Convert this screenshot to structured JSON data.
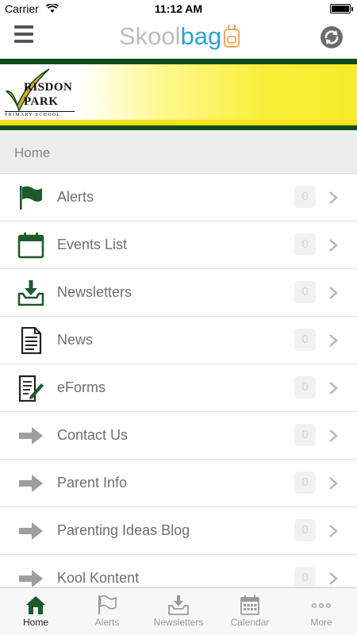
{
  "status_bar": {
    "carrier": "Carrier",
    "time": "11:12 AM"
  },
  "navbar": {
    "brand_part1": "Skool",
    "brand_part2": "bag"
  },
  "banner": {
    "school_line1": "RISDON",
    "school_line2": "PARK",
    "school_line3": "PRIMARY SCHOOL"
  },
  "section": {
    "title": "Home"
  },
  "menu_items": [
    {
      "label": "Alerts",
      "count": "0",
      "icon": "flag-icon"
    },
    {
      "label": "Events List",
      "count": "0",
      "icon": "calendar-icon"
    },
    {
      "label": "Newsletters",
      "count": "0",
      "icon": "inbox-download-icon"
    },
    {
      "label": "News",
      "count": "0",
      "icon": "document-icon"
    },
    {
      "label": "eForms",
      "count": "0",
      "icon": "form-edit-icon"
    },
    {
      "label": "Contact Us",
      "count": "0",
      "icon": "arrow-right-icon"
    },
    {
      "label": "Parent Info",
      "count": "0",
      "icon": "arrow-right-icon"
    },
    {
      "label": "Parenting Ideas Blog",
      "count": "0",
      "icon": "arrow-right-icon"
    },
    {
      "label": "Kool Kontent",
      "count": "0",
      "icon": "arrow-right-icon"
    }
  ],
  "tabs": [
    {
      "label": "Home",
      "icon": "home-icon",
      "active": true
    },
    {
      "label": "Alerts",
      "icon": "flag-icon",
      "active": false
    },
    {
      "label": "Newsletters",
      "icon": "inbox-download-icon",
      "active": false
    },
    {
      "label": "Calendar",
      "icon": "calendar-icon",
      "active": false
    },
    {
      "label": "More",
      "icon": "more-dots-icon",
      "active": false
    }
  ],
  "colors": {
    "accent_green": "#1f5a2a",
    "brand_blue": "#2aa3d8",
    "banner_dark": "#0d4a1c",
    "banner_yellow": "#f7ec2a"
  }
}
